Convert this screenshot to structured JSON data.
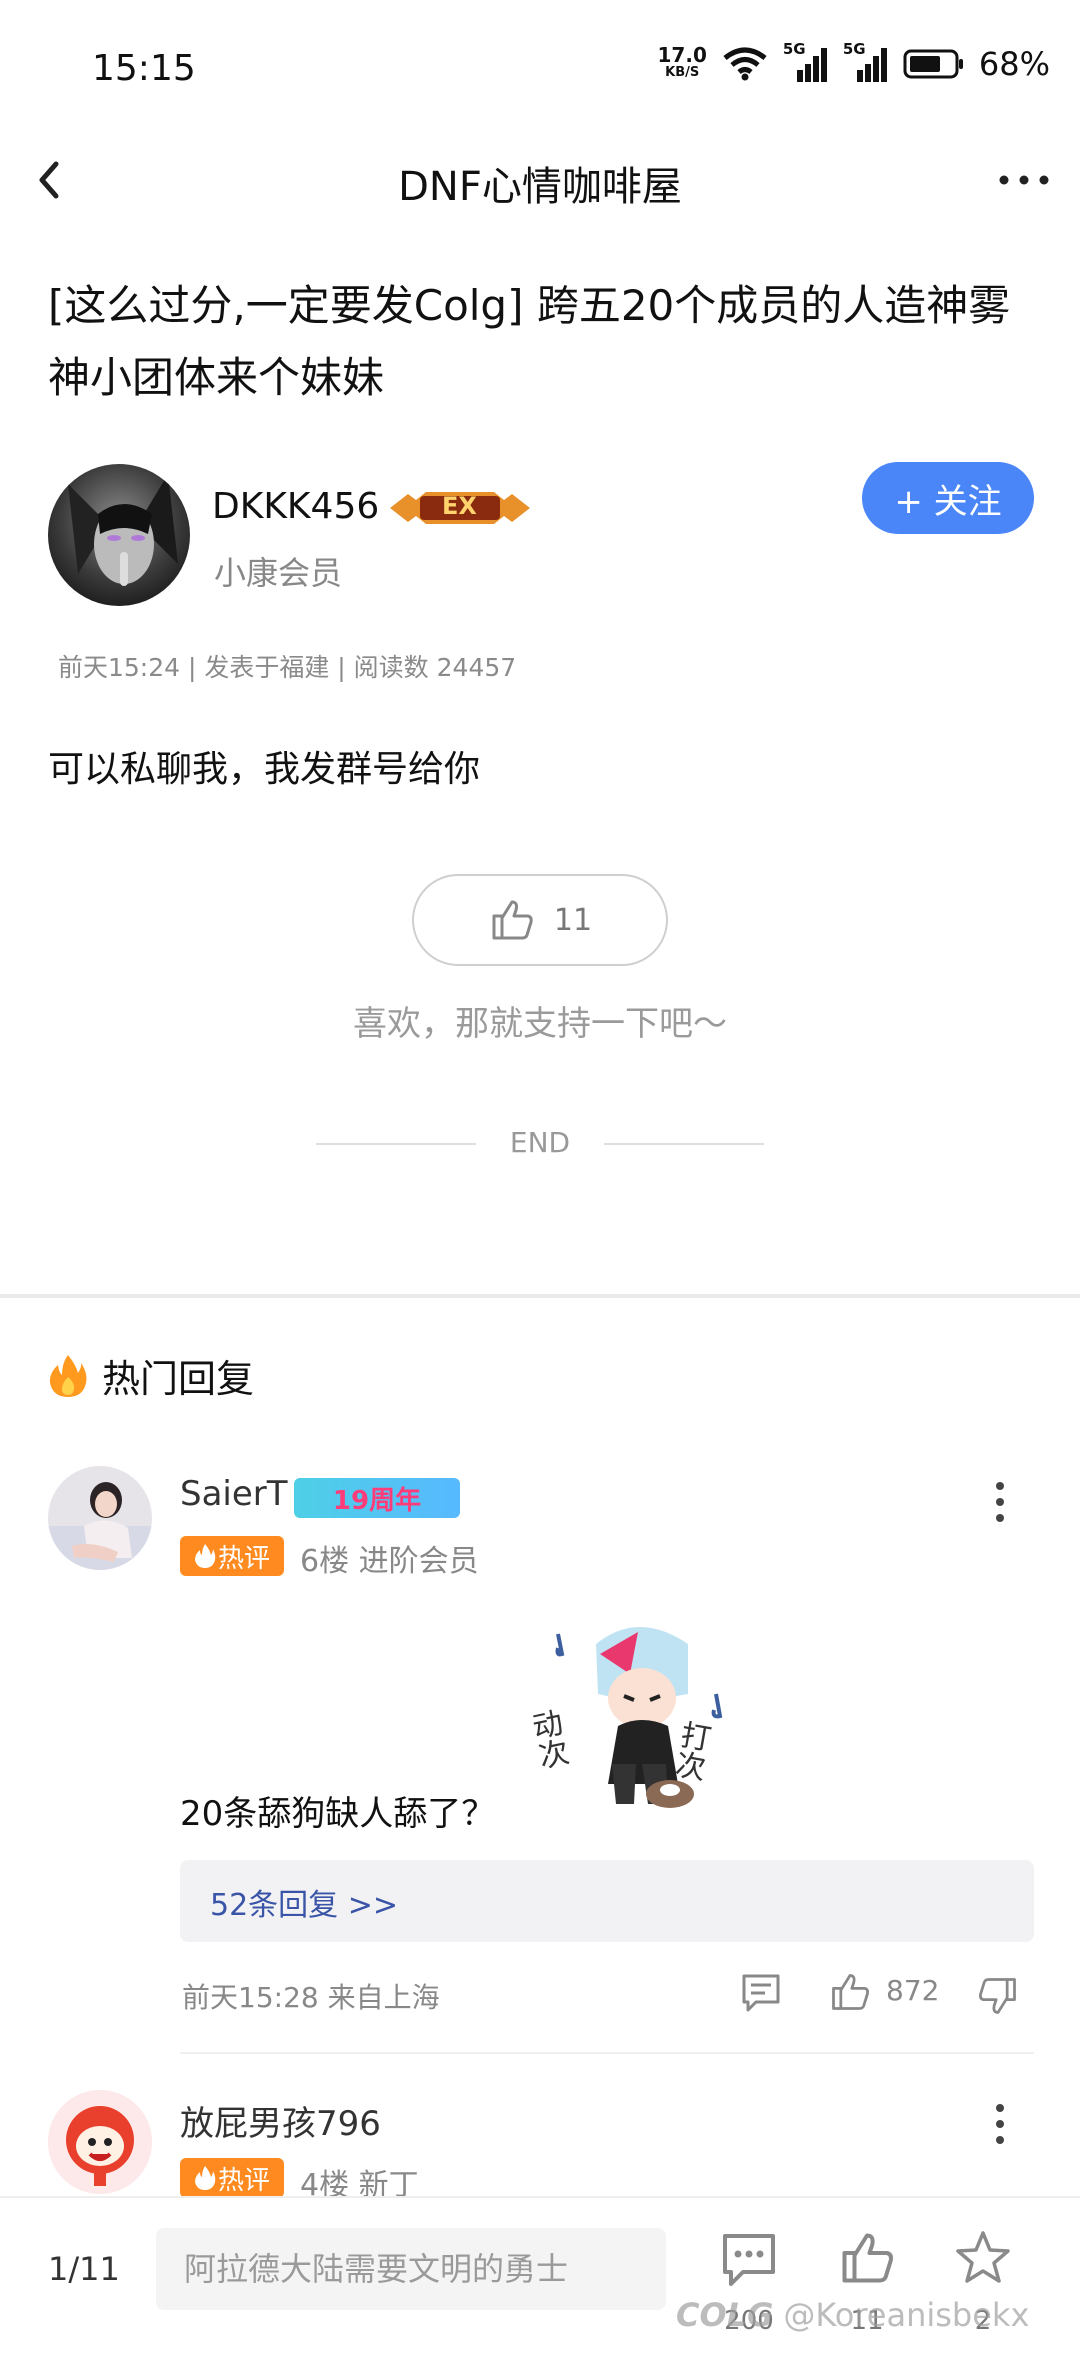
{
  "status_bar": {
    "time": "15:15",
    "net_speed": "17.0",
    "net_speed_unit": "KB/S",
    "signal_label_1": "5G",
    "signal_label_2": "5G",
    "battery": "68%"
  },
  "nav": {
    "title": "DNF心情咖啡屋",
    "back_icon": "chevron-left-icon",
    "more_icon": "more-horizontal-icon"
  },
  "post": {
    "title": "[这么过分,一定要发Colg] 跨五20个成员的人造神雾神小团体来个妹妹",
    "author": {
      "name": "DKKK456",
      "badge": "EX",
      "role": "小康会员"
    },
    "follow_label": "+ 关注",
    "meta": "前天15:24 | 发表于福建 | 阅读数 24457",
    "body": "可以私聊我，我发群号给你",
    "likes": "11",
    "support_text": "喜欢，那就支持一下吧～",
    "end_label": "END"
  },
  "hot_replies": {
    "header": "热门回复",
    "tag_label": "热评",
    "items": [
      {
        "name": "SaierT",
        "badge": "19周年",
        "sub": "6楼 进阶会员",
        "sticker_text_1": "动次",
        "sticker_text_2": "打次",
        "text": "20条舔狗缺人舔了？",
        "replies_link": "52条回复 >>",
        "time": "前天15:28 来自上海",
        "likes": "872"
      },
      {
        "name": "放屁男孩796",
        "sub": "4楼 新丁"
      }
    ]
  },
  "bottom_bar": {
    "page": "1/11",
    "input_placeholder": "阿拉德大陆需要文明的勇士",
    "comments": "200",
    "likes": "11",
    "favorites": "2",
    "watermark": "@Koreanisbekx",
    "watermark_logo": "COLG"
  },
  "colors": {
    "accent_blue": "#4a86f7",
    "hot_orange": "#ff8a1f",
    "reply_link": "#3a55a8"
  }
}
